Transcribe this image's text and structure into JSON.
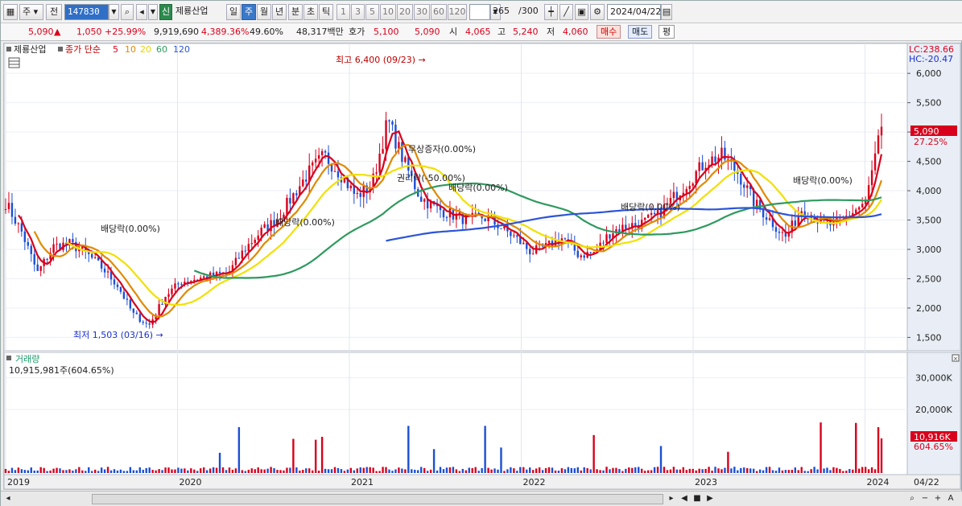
{
  "toolbar": {
    "period_select": "주",
    "prev_label": "전",
    "code": "147830",
    "sin_badge": "신",
    "stock_name": "제룡산업",
    "periods": [
      "일",
      "주",
      "월",
      "년",
      "분",
      "초",
      "틱"
    ],
    "selected_period": "주",
    "intervals": [
      "1",
      "3",
      "5",
      "10",
      "20",
      "30",
      "60",
      "120"
    ],
    "count": "265",
    "count_total": "/300",
    "date": "2024/04/22"
  },
  "quote": {
    "price": "5,090",
    "change": "1,050",
    "change_pct": "+25.99%",
    "volume": "9,919,690",
    "volume_pct": "4,389.36%",
    "turnover_pct": "49.60%",
    "amount": "48,317백만",
    "hoga_label": "호가",
    "hoga_ask": "5,100",
    "hoga_bid": "5,090",
    "open_label": "시",
    "open": "4,065",
    "high_label": "고",
    "high": "5,240",
    "low_label": "저",
    "low": "4,060",
    "buy_label": "매수",
    "sell_label": "매도",
    "even_label": "평"
  },
  "price_panel": {
    "name_label": "제룡산업",
    "indicator_label": "종가 단순",
    "ma_periods": [
      "5",
      "10",
      "20",
      "60",
      "120"
    ],
    "ma_colors": [
      "#d8001c",
      "#e08a00",
      "#f2e000",
      "#2e9a5e",
      "#2c54d8"
    ],
    "lc": "LC:238.66",
    "hc": "HC:-20.47",
    "last_price_tag": "5,090",
    "last_pct_tag": "27.25%",
    "high_annot": "최고 6,400 (09/23)",
    "low_annot": "최저 1,503 (03/16)",
    "events": [
      "배당락(0.00%)",
      "배당락(0.00%)",
      "무상증자(0.00%)",
      "권리락(-50.00%)",
      "배당락(0.00%)",
      "배당락(0.00%)",
      "배당락(0.00%)"
    ],
    "y_ticks": [
      "6,000",
      "5,500",
      "5,000",
      "4,500",
      "4,000",
      "3,500",
      "3,000",
      "2,500",
      "2,000",
      "1,500"
    ]
  },
  "volume_panel": {
    "title": "거래량",
    "value": "10,915,981주(604.65%)",
    "y_ticks": [
      "30,000K",
      "20,000K"
    ],
    "last_tag": "10,916K",
    "last_pct": "604.65%"
  },
  "x_axis": {
    "labels": [
      "2019",
      "2020",
      "2021",
      "2022",
      "2023",
      "2024"
    ],
    "end_label": "04/22"
  },
  "chart_data": {
    "type": "line",
    "x_unit": "week",
    "x": [
      "2019",
      "2020",
      "2021",
      "2022",
      "2023",
      "2024",
      "04/22"
    ],
    "series": [
      {
        "name": "종가",
        "values": [
          3800,
          3300,
          2600,
          3050,
          3100,
          2950,
          2700,
          2400,
          1900,
          1700,
          2200,
          2450,
          2500,
          2550,
          2600,
          3000,
          3300,
          3500,
          3900,
          4300,
          4600,
          4300,
          3900,
          4100,
          5200,
          4500,
          3900,
          3700,
          3600,
          3500,
          3550,
          3400,
          3200,
          2950,
          3050,
          3200,
          2900,
          2950,
          3300,
          3400,
          3450,
          3600,
          3900,
          4200,
          4500,
          4600,
          4300,
          3800,
          3500,
          3200,
          3700,
          3500,
          3400,
          3600,
          3800,
          5090
        ]
      }
    ],
    "ylim": [
      1300,
      6400
    ]
  }
}
